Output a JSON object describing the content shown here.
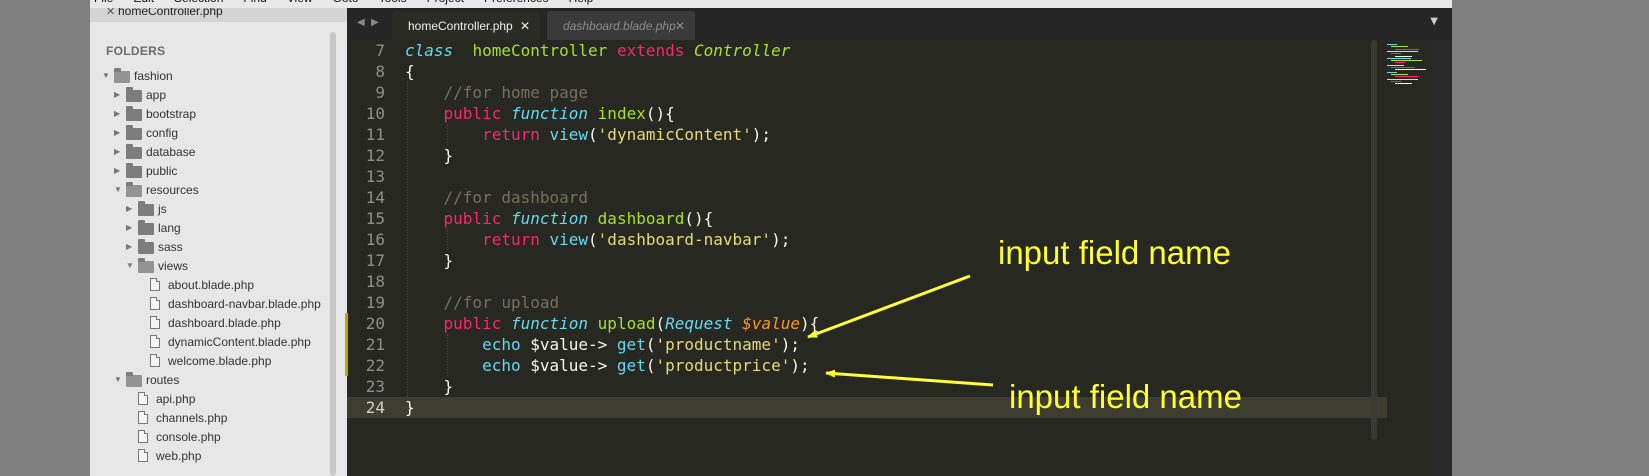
{
  "menu": [
    "File",
    "Edit",
    "Selection",
    "Find",
    "View",
    "Goto",
    "Tools",
    "Project",
    "Preferences",
    "Help"
  ],
  "sidebar": {
    "open_file": "homeController.php",
    "close_glyph": "✕",
    "folders_title": "FOLDERS",
    "tree": [
      {
        "label": "fashion",
        "depth": 0,
        "kind": "folder",
        "open": true
      },
      {
        "label": "app",
        "depth": 1,
        "kind": "folder",
        "open": false
      },
      {
        "label": "bootstrap",
        "depth": 1,
        "kind": "folder",
        "open": false
      },
      {
        "label": "config",
        "depth": 1,
        "kind": "folder",
        "open": false
      },
      {
        "label": "database",
        "depth": 1,
        "kind": "folder",
        "open": false
      },
      {
        "label": "public",
        "depth": 1,
        "kind": "folder",
        "open": false
      },
      {
        "label": "resources",
        "depth": 1,
        "kind": "folder",
        "open": true
      },
      {
        "label": "js",
        "depth": 2,
        "kind": "folder",
        "open": false
      },
      {
        "label": "lang",
        "depth": 2,
        "kind": "folder",
        "open": false
      },
      {
        "label": "sass",
        "depth": 2,
        "kind": "folder",
        "open": false
      },
      {
        "label": "views",
        "depth": 2,
        "kind": "folder",
        "open": true
      },
      {
        "label": "about.blade.php",
        "depth": 3,
        "kind": "file"
      },
      {
        "label": "dashboard-navbar.blade.php",
        "depth": 3,
        "kind": "file"
      },
      {
        "label": "dashboard.blade.php",
        "depth": 3,
        "kind": "file"
      },
      {
        "label": "dynamicContent.blade.php",
        "depth": 3,
        "kind": "file"
      },
      {
        "label": "welcome.blade.php",
        "depth": 3,
        "kind": "file"
      },
      {
        "label": "routes",
        "depth": 1,
        "kind": "folder",
        "open": true
      },
      {
        "label": "api.php",
        "depth": 2,
        "kind": "file"
      },
      {
        "label": "channels.php",
        "depth": 2,
        "kind": "file"
      },
      {
        "label": "console.php",
        "depth": 2,
        "kind": "file"
      },
      {
        "label": "web.php",
        "depth": 2,
        "kind": "file"
      }
    ]
  },
  "tabs": {
    "nav_prev": "◀",
    "nav_next": "▶",
    "active": {
      "title": "homeController.php",
      "close": "✕"
    },
    "inactive": {
      "title": "dashboard.blade.php",
      "close": "✕"
    },
    "dropdown": "▼"
  },
  "editor": {
    "current_line": 24,
    "modified_lines": [
      20,
      21,
      22
    ],
    "lines": [
      {
        "n": 7,
        "tokens": [
          [
            "kw",
            "class"
          ],
          [
            "",
            "  "
          ],
          [
            "ent",
            "homeController"
          ],
          [
            "",
            " "
          ],
          [
            "stor",
            "extends"
          ],
          [
            "",
            " "
          ],
          [
            "inh",
            "Controller"
          ]
        ]
      },
      {
        "n": 8,
        "tokens": [
          [
            "",
            "{"
          ]
        ]
      },
      {
        "n": 9,
        "tokens": [
          [
            "",
            "    "
          ],
          [
            "cmt",
            "//for home page"
          ]
        ]
      },
      {
        "n": 10,
        "tokens": [
          [
            "",
            "    "
          ],
          [
            "stor",
            "public"
          ],
          [
            "",
            " "
          ],
          [
            "kw",
            "function"
          ],
          [
            "",
            " "
          ],
          [
            "fn",
            "index"
          ],
          [
            "",
            "(){"
          ]
        ]
      },
      {
        "n": 11,
        "tokens": [
          [
            "",
            "        "
          ],
          [
            "stor",
            "return"
          ],
          [
            "",
            " "
          ],
          [
            "sup",
            "view"
          ],
          [
            "",
            "("
          ],
          [
            "str",
            "'dynamicContent'"
          ],
          [
            "",
            ");"
          ]
        ]
      },
      {
        "n": 12,
        "tokens": [
          [
            "",
            "    }"
          ]
        ]
      },
      {
        "n": 13,
        "tokens": []
      },
      {
        "n": 14,
        "tokens": [
          [
            "",
            "    "
          ],
          [
            "cmt",
            "//for dashboard"
          ]
        ]
      },
      {
        "n": 15,
        "tokens": [
          [
            "",
            "    "
          ],
          [
            "stor",
            "public"
          ],
          [
            "",
            " "
          ],
          [
            "kw",
            "function"
          ],
          [
            "",
            " "
          ],
          [
            "fn",
            "dashboard"
          ],
          [
            "",
            "(){"
          ]
        ]
      },
      {
        "n": 16,
        "tokens": [
          [
            "",
            "        "
          ],
          [
            "stor",
            "return"
          ],
          [
            "",
            " "
          ],
          [
            "sup",
            "view"
          ],
          [
            "",
            "("
          ],
          [
            "str",
            "'dashboard-navbar'"
          ],
          [
            "",
            ");"
          ]
        ]
      },
      {
        "n": 17,
        "tokens": [
          [
            "",
            "    }"
          ]
        ]
      },
      {
        "n": 18,
        "tokens": []
      },
      {
        "n": 19,
        "tokens": [
          [
            "",
            "    "
          ],
          [
            "cmt",
            "//for upload"
          ]
        ]
      },
      {
        "n": 20,
        "tokens": [
          [
            "",
            "    "
          ],
          [
            "stor",
            "public"
          ],
          [
            "",
            " "
          ],
          [
            "kw",
            "function"
          ],
          [
            "",
            " "
          ],
          [
            "fn",
            "upload"
          ],
          [
            "",
            "("
          ],
          [
            "cls",
            "Request"
          ],
          [
            "",
            " "
          ],
          [
            "par",
            "$value"
          ],
          [
            "",
            "){"
          ]
        ]
      },
      {
        "n": 21,
        "tokens": [
          [
            "",
            "        "
          ],
          [
            "ech",
            "echo"
          ],
          [
            "",
            " $value-> "
          ],
          [
            "sup",
            "get"
          ],
          [
            "",
            "("
          ],
          [
            "str",
            "'productname'"
          ],
          [
            "",
            ");"
          ]
        ]
      },
      {
        "n": 22,
        "tokens": [
          [
            "",
            "        "
          ],
          [
            "ech",
            "echo"
          ],
          [
            "",
            " $value-> "
          ],
          [
            "sup",
            "get"
          ],
          [
            "",
            "("
          ],
          [
            "str",
            "'productprice'"
          ],
          [
            "",
            ");"
          ]
        ]
      },
      {
        "n": 23,
        "tokens": [
          [
            "",
            "    }"
          ]
        ]
      },
      {
        "n": 24,
        "tokens": [
          [
            "",
            "}"
          ]
        ]
      }
    ]
  },
  "annotations": {
    "label_1": "input field name",
    "label_2": "input field name",
    "color": "#ffff33"
  }
}
